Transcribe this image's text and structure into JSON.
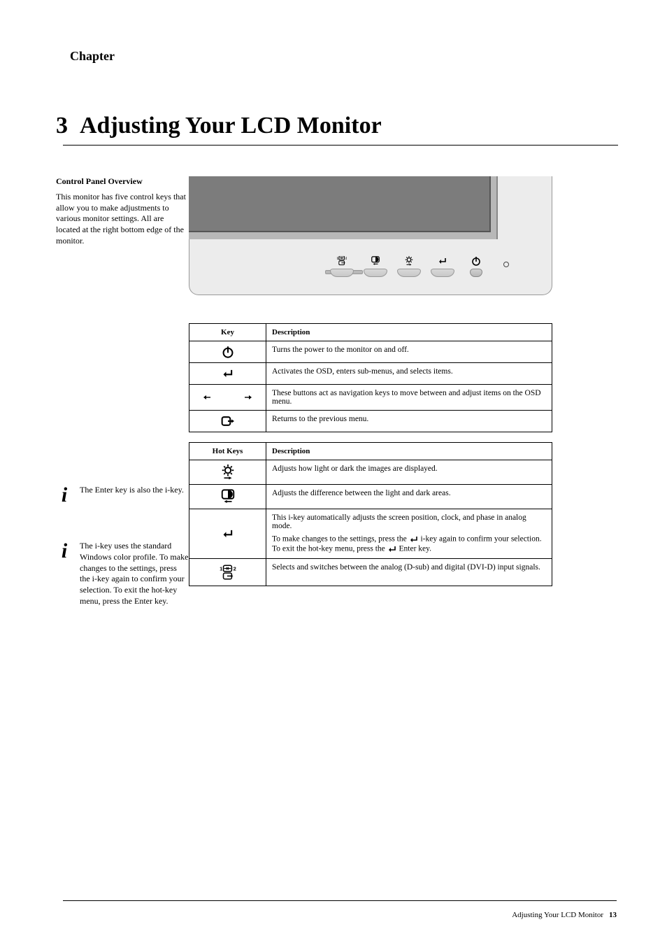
{
  "chapter_label": "Chapter",
  "chapter_number": "3",
  "page_title": "Adjusting Your LCD Monitor",
  "sidebar": {
    "section_heading": "Control Panel Overview",
    "section_body": "This monitor has five control keys that allow you to make adjustments to various monitor settings. All are located at the right bottom edge of the monitor.",
    "ikey1": "The Enter key is also the i-key.",
    "ikey2": "The i-key uses the standard Windows color profile. To make changes to the settings, press the i-key again to confirm your selection. To exit the hot-key menu, press the Enter key."
  },
  "icons": {
    "input_switch": "input-source-icon",
    "contrast": "contrast-icon",
    "brightness": "brightness-icon",
    "enter": "enter-icon",
    "power": "power-icon",
    "led": "led-indicator",
    "exit": "exit-icon"
  },
  "table1": {
    "h_key": "Key",
    "h_desc": "Description",
    "rows": [
      {
        "icon": "power",
        "desc": "Turns the power to the monitor on and off."
      },
      {
        "icon": "enter",
        "desc": "Activates the OSD, enters sub-menus, and selects items."
      },
      {
        "icon": "arrows",
        "desc": "These buttons act as navigation keys to move between and adjust items on the OSD menu."
      },
      {
        "icon": "exit",
        "desc": "Returns to the previous menu."
      }
    ]
  },
  "table2": {
    "h_key": "Hot Keys",
    "h_desc": "Description",
    "rows": [
      {
        "icon": "brightness",
        "desc": "Adjusts how light or dark the images are displayed."
      },
      {
        "icon": "contrast",
        "desc": "Adjusts the difference between the light and dark areas."
      },
      {
        "icon": "enter",
        "desc_a": "This i-key automatically adjusts the screen position, clock, and phase in analog mode.",
        "desc_b_pre": "To make changes to the settings, press the ",
        "desc_b_post": " i-key again to confirm your selection. To exit the hot-key menu, press the ",
        "desc_b_end": " Enter key."
      },
      {
        "icon": "input",
        "desc": "Selects and switches between the analog (D-sub) and digital (DVI-D) input signals."
      }
    ]
  },
  "footer": {
    "book": "Adjusting Your LCD Monitor",
    "page": "13"
  }
}
